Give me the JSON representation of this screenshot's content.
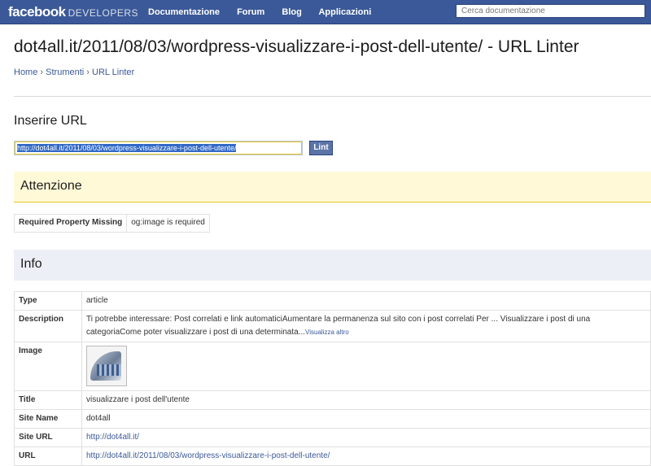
{
  "header": {
    "logo_main": "facebook",
    "logo_sub": "DEVELOPERS",
    "nav": [
      "Documentazione",
      "Forum",
      "Blog",
      "Applicazioni"
    ],
    "search_placeholder": "Cerca documentazione"
  },
  "page": {
    "title": "dot4all.it/2011/08/03/wordpress-visualizzare-i-post-dell-utente/ - URL Linter",
    "breadcrumb": [
      "Home",
      "Strumenti",
      "URL Linter"
    ],
    "breadcrumb_sep": "›"
  },
  "form": {
    "label": "Inserire URL",
    "url_value": "http://dot4all.it/2011/08/03/wordpress-visualizzare-i-post-dell-utente/",
    "button": "Lint"
  },
  "warning": {
    "heading": "Attenzione",
    "rows": [
      {
        "key": "Required Property Missing",
        "value": "og:image is required"
      }
    ]
  },
  "info": {
    "heading": "Info",
    "type_label": "Type",
    "type_value": "article",
    "description_label": "Description",
    "description_value": "Ti potrebbe interessare: Post correlati e link automaticiAumentare la permanenza sul sito con i post correlati Per ... Visualizzare i post di una categoriaCome poter visualizzare i post di una determinata...",
    "description_more": "Visualizza altro",
    "image_label": "Image",
    "title_label": "Title",
    "title_value": "visualizzare i post dell'utente",
    "site_name_label": "Site Name",
    "site_name_value": "dot4all",
    "site_url_label": "Site URL",
    "site_url_value": "http://dot4all.it/",
    "url_label": "URL",
    "url_value": "http://dot4all.it/2011/08/03/wordpress-visualizzare-i-post-dell-utente/"
  },
  "colors": {
    "brand": "#3b5998",
    "warning_bg": "#fff9d7",
    "info_bg": "#eceff5"
  }
}
